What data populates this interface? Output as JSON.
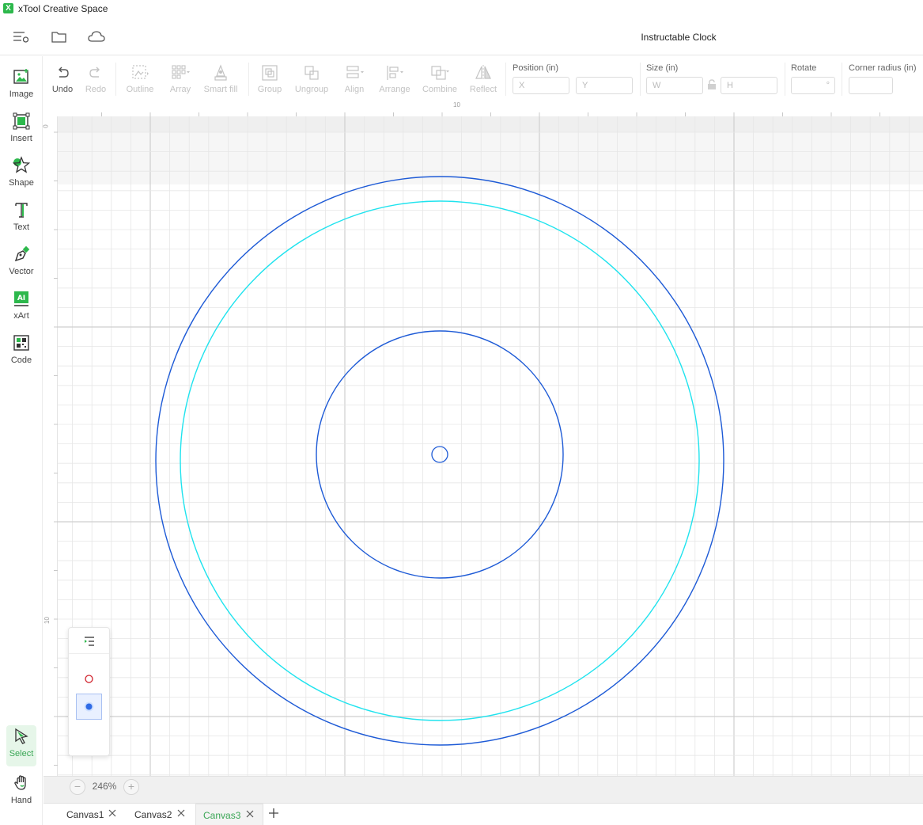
{
  "app": {
    "title": "xTool Creative Space",
    "logo_glyph": "X"
  },
  "header": {
    "document_title": "Instructable Clock",
    "icons": [
      "menu-icon",
      "folder-icon",
      "cloud-icon"
    ]
  },
  "left_tools": [
    {
      "key": "image",
      "label": "Image",
      "icon": "image-icon"
    },
    {
      "key": "insert",
      "label": "Insert",
      "icon": "insert-icon"
    },
    {
      "key": "shape",
      "label": "Shape",
      "icon": "star-icon"
    },
    {
      "key": "text",
      "label": "Text",
      "icon": "text-icon"
    },
    {
      "key": "vector",
      "label": "Vector",
      "icon": "pen-icon"
    },
    {
      "key": "xart",
      "label": "xArt",
      "icon": "ai-icon"
    },
    {
      "key": "code",
      "label": "Code",
      "icon": "barcode-icon"
    }
  ],
  "bottom_tools": [
    {
      "key": "select",
      "label": "Select",
      "icon": "cursor-icon",
      "active": true
    },
    {
      "key": "hand",
      "label": "Hand",
      "icon": "hand-icon",
      "active": false
    }
  ],
  "toolbar": {
    "undo": "Undo",
    "redo": "Redo",
    "outline": "Outline",
    "array": "Array",
    "smart_fill": "Smart fill",
    "group": "Group",
    "ungroup": "Ungroup",
    "align": "Align",
    "arrange": "Arrange",
    "combine": "Combine",
    "reflect": "Reflect"
  },
  "properties": {
    "position_label": "Position (in)",
    "x_placeholder": "X",
    "y_placeholder": "Y",
    "size_label": "Size (in)",
    "w_placeholder": "W",
    "h_placeholder": "H",
    "rotate_label": "Rotate",
    "rotate_unit": "°",
    "corner_label": "Corner radius (in)"
  },
  "rulers": {
    "h_label": "10",
    "v_zero": "0",
    "v_label": "10"
  },
  "layers": [
    {
      "name": "layer-red",
      "color": "#d0212b",
      "mode": "outline"
    },
    {
      "name": "layer-blue",
      "color": "#2f6be6",
      "mode": "filled",
      "selected": true
    }
  ],
  "shapes": [
    {
      "name": "outer-circle",
      "color": "#1d5ad6"
    },
    {
      "name": "score-circle",
      "color": "#1fe3ee"
    },
    {
      "name": "inner-circle",
      "color": "#1d5ad6"
    },
    {
      "name": "center-hole",
      "color": "#1d5ad6"
    }
  ],
  "zoom": {
    "level": "246%",
    "minus": "−",
    "plus": "+"
  },
  "tabs": [
    {
      "label": "Canvas1",
      "active": false
    },
    {
      "label": "Canvas2",
      "active": false
    },
    {
      "label": "Canvas3",
      "active": true
    }
  ],
  "colors": {
    "accent": "#3aa655",
    "grid_minor": "#e6e6e6",
    "grid_major": "#cfcfcf"
  }
}
